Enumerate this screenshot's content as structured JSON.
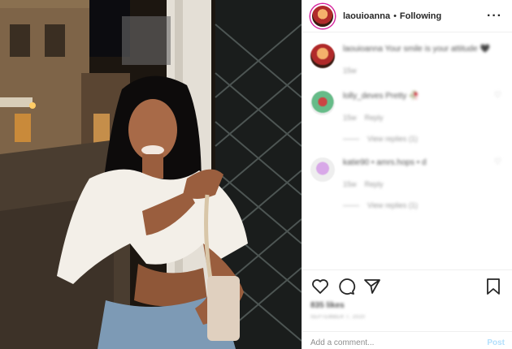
{
  "post": {
    "username": "laouioanna",
    "separator": "•",
    "follow_status": "Following",
    "more_icon": "more-horizontal-icon"
  },
  "caption": {
    "text": "laouioanna Your smile is your attitude 🖤",
    "time": "15w"
  },
  "comments": [
    {
      "text": "lolly_deves Pretty 🥀",
      "time": "15w",
      "reply_label": "Reply",
      "view_replies": "View replies (1)"
    },
    {
      "text": "katie90 • amrs.hops • d",
      "time": "15w",
      "reply_label": "Reply",
      "view_replies": "View replies (1)"
    }
  ],
  "actions": {
    "likes": "835 likes",
    "date": "SEPTEMBER 7, 2020"
  },
  "add_comment": {
    "placeholder": "Add a comment...",
    "post_label": "Post"
  },
  "colors": {
    "border": "#efefef",
    "post_button": "#b2dffc",
    "muted": "#8e8e8e"
  }
}
